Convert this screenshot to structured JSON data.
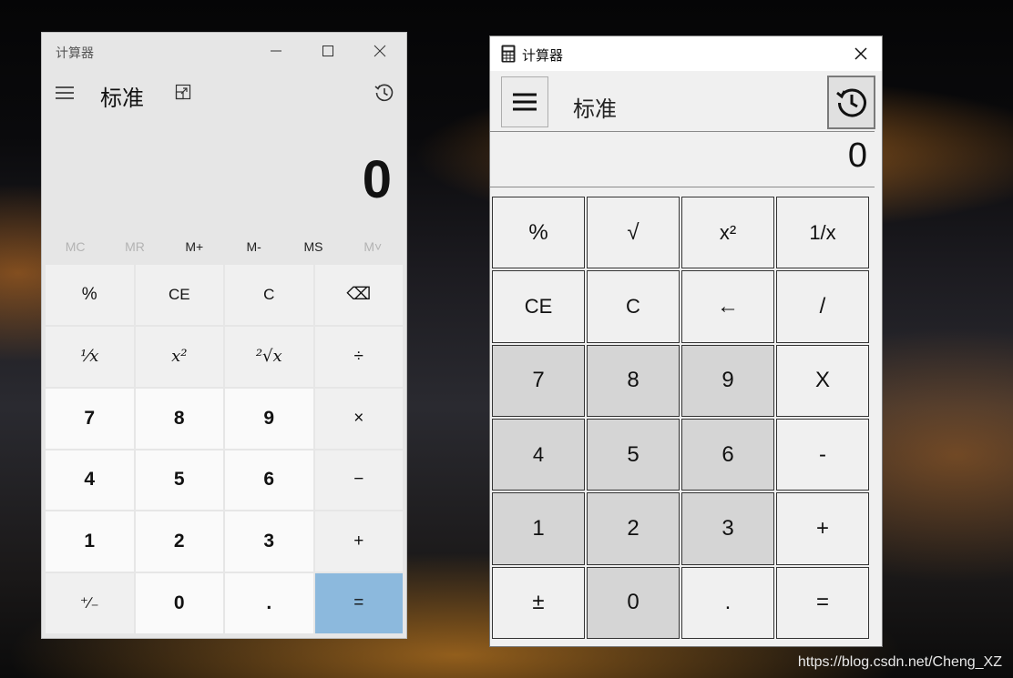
{
  "watermark": "https://blog.csdn.net/Cheng_XZ",
  "left_calc": {
    "title": "计算器",
    "mode": "标准",
    "display": "0",
    "memory": [
      "MC",
      "MR",
      "M+",
      "M-",
      "MS",
      "M˅"
    ],
    "memory_disabled": [
      true,
      true,
      false,
      false,
      false,
      true
    ],
    "keys": [
      "%",
      "CE",
      "C",
      "⌫",
      "⅟x",
      "x²",
      "²√x",
      "÷",
      "7",
      "8",
      "9",
      "×",
      "4",
      "5",
      "6",
      "−",
      "1",
      "2",
      "3",
      "+",
      "⁺∕₋",
      "0",
      ".",
      "="
    ],
    "key_kinds": [
      "op",
      "op",
      "op",
      "op",
      "op",
      "op",
      "op",
      "op",
      "num",
      "num",
      "num",
      "op",
      "num",
      "num",
      "num",
      "op",
      "num",
      "num",
      "num",
      "op",
      "op",
      "num",
      "num",
      "eq"
    ],
    "equals_color": "#8cb9dd"
  },
  "right_calc": {
    "title": "计算器",
    "mode": "标准",
    "display": "0",
    "keys": [
      "%",
      "√",
      "x²",
      "1/x",
      "CE",
      "C",
      "←",
      "/",
      "7",
      "8",
      "9",
      "X",
      "4",
      "5",
      "6",
      "-",
      "1",
      "2",
      "3",
      "+",
      "±",
      "0",
      ".",
      "="
    ],
    "key_kinds": [
      "op",
      "op",
      "op",
      "op",
      "op",
      "op",
      "op",
      "op",
      "num",
      "num",
      "num",
      "op",
      "num",
      "num",
      "num",
      "op",
      "num",
      "num",
      "num",
      "op",
      "op",
      "num",
      "op",
      "op"
    ],
    "digit_key_color": "#d5d5d5"
  }
}
